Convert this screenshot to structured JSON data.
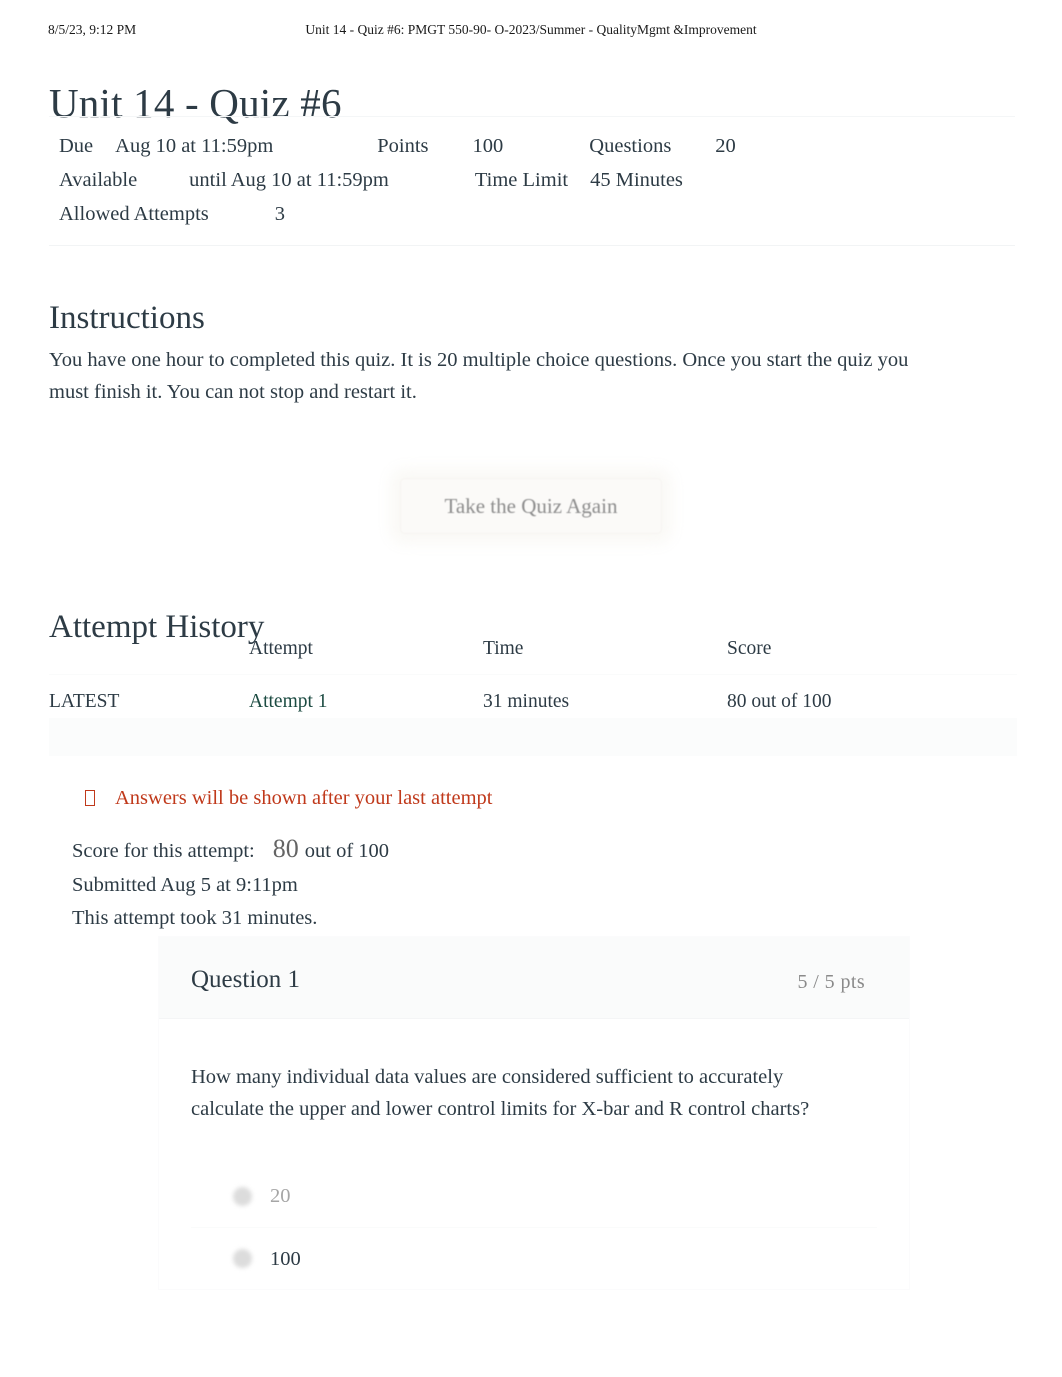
{
  "print_header": {
    "date": "8/5/23, 9:12 PM",
    "title": "Unit 14 - Quiz #6: PMGT 550-90- O-2023/Summer - QualityMgmt &Improvement"
  },
  "page": {
    "title": "Unit 14 - Quiz #6"
  },
  "quiz_meta": {
    "due_label": "Due",
    "due_value": "Aug 10 at 11:59pm",
    "points_label": "Points",
    "points_value": "100",
    "questions_label": "Questions",
    "questions_value": "20",
    "available_label": "Available",
    "available_value": "until Aug 10 at 11:59pm",
    "time_limit_label": "Time Limit",
    "time_limit_value": "45 Minutes",
    "allowed_attempts_label": "Allowed Attempts",
    "allowed_attempts_value": "3"
  },
  "instructions": {
    "heading": "Instructions",
    "body": "You have one hour to completed this quiz. It is 20 multiple choice questions. Once you start the quiz you must finish it. You can not stop and restart it."
  },
  "retake": {
    "label": "Take the Quiz Again"
  },
  "attempt_history": {
    "heading": "Attempt History",
    "columns": {
      "kept": "",
      "attempt": "Attempt",
      "time": "Time",
      "score": "Score"
    },
    "rows": [
      {
        "kept": "LATEST",
        "attempt": "Attempt 1",
        "time": "31 minutes",
        "score": "80 out of 100"
      }
    ]
  },
  "answers_notice": {
    "icon": "exclamation-box-icon",
    "text": "Answers will be shown after your last attempt",
    "color": "#c0391b"
  },
  "attempt_summary": {
    "score_label": "Score for this attempt:",
    "score_value": "80",
    "score_suffix": "out of 100",
    "submitted": "Submitted Aug 5 at 9:11pm",
    "duration": "This attempt took 31 minutes."
  },
  "question": {
    "name": "Question 1",
    "points": "5 / 5 pts",
    "text": "How many individual data values are considered sufficient to accurately calculate the upper and lower control limits for X-bar and R control charts?",
    "answers": [
      {
        "label": "20"
      },
      {
        "label": "100"
      }
    ]
  },
  "colors": {
    "text": "#2d3b45",
    "link": "#1c4b42",
    "warning": "#c0391b",
    "muted": "#8a8a8a"
  }
}
